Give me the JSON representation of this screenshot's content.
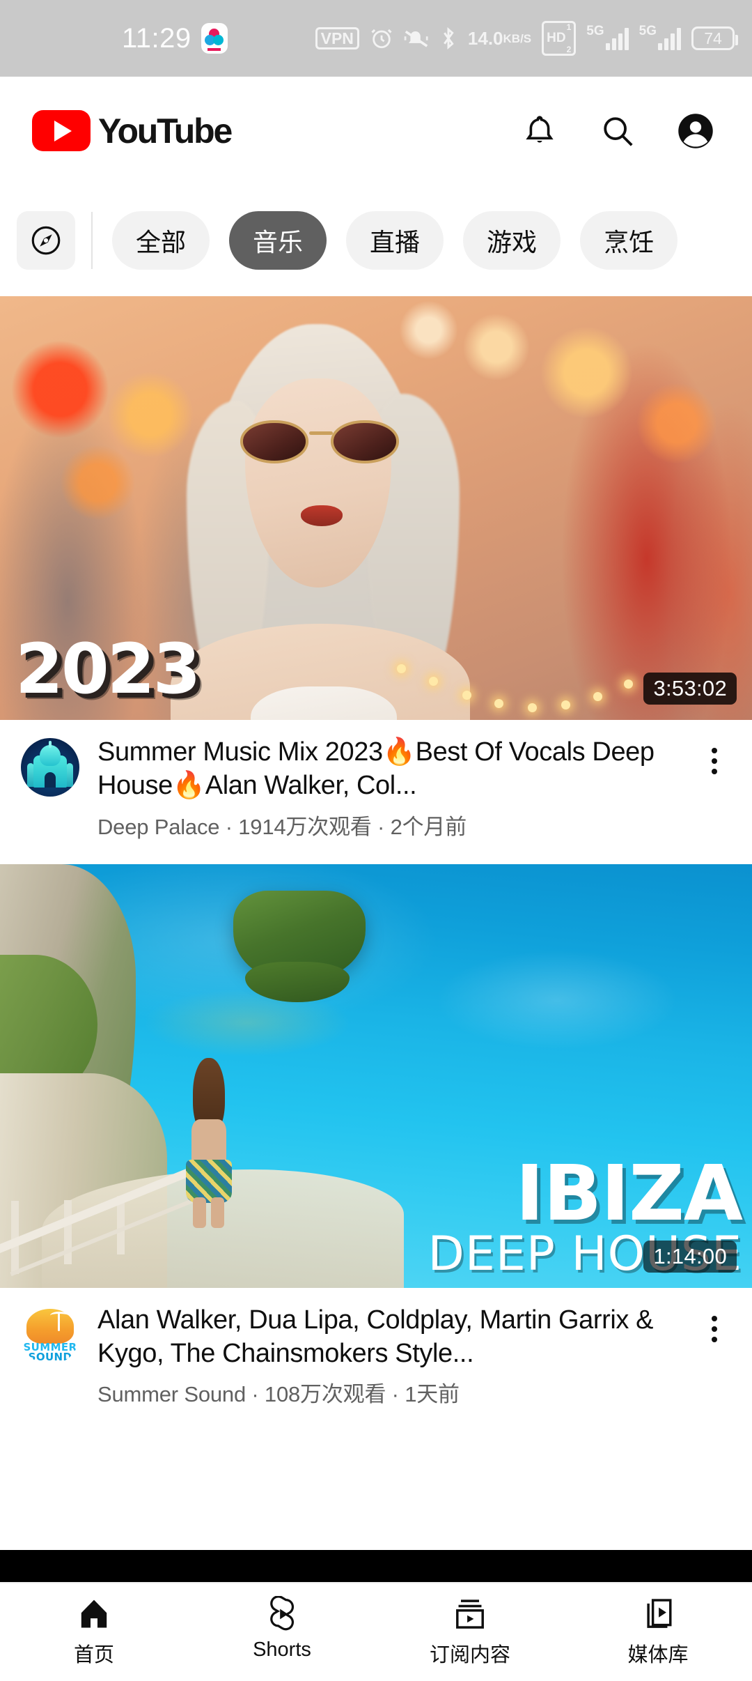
{
  "statusbar": {
    "time": "11:29",
    "app_icon": "mi-cloud-icon",
    "vpn_label": "VPN",
    "alarm_icon": "alarm-clock-icon",
    "mute_icon": "bell-muted-icon",
    "bluetooth_icon": "bluetooth-icon",
    "netspeed_value": "14.0",
    "netspeed_unit": "KB/S",
    "hd_label": "HD",
    "hd_sup": "1",
    "hd_sub": "2",
    "sim1_label": "5G",
    "sim2_label": "5G",
    "battery": "74"
  },
  "header": {
    "logo_text": "YouTube",
    "notifications_icon": "bell-icon",
    "search_icon": "search-icon",
    "account_icon": "account-avatar-icon"
  },
  "chips": {
    "explore_icon": "compass-icon",
    "items": [
      {
        "label": "全部",
        "active": false
      },
      {
        "label": "音乐",
        "active": true
      },
      {
        "label": "直播",
        "active": false
      },
      {
        "label": "游戏",
        "active": false
      },
      {
        "label": "烹饪",
        "active": false
      }
    ]
  },
  "feed": {
    "videos": [
      {
        "title": "Summer Music Mix 2023🔥Best Of Vocals Deep House🔥Alan Walker, Col...",
        "channel": "Deep Palace",
        "views": "1914万次观看",
        "age": "2个月前",
        "meta_line": "Deep Palace · 1914万次观看 · 2个月前",
        "duration": "3:53:02",
        "thumb_overlay_text": "2023",
        "avatar_name": "deep-palace-avatar",
        "menu_icon": "kebab-menu-icon"
      },
      {
        "title": "Alan Walker, Dua Lipa, Coldplay, Martin Garrix & Kygo, The Chainsmokers Style...",
        "channel": "Summer Sound",
        "views": "108万次观看",
        "age": "1天前",
        "meta_line": "Summer Sound · 108万次观看 · 1天前",
        "duration": "1:14:00",
        "thumb_overlay_title": "IBIZA",
        "thumb_overlay_sub": "DEEP HOUSE",
        "avatar_name": "summer-sound-avatar",
        "avatar_text_line1": "SUMMER",
        "avatar_text_line2": "SOUND",
        "menu_icon": "kebab-menu-icon"
      }
    ]
  },
  "bottom_nav": {
    "items": [
      {
        "label": "首页",
        "icon": "home-icon",
        "active": true
      },
      {
        "label": "Shorts",
        "icon": "shorts-icon",
        "active": false
      },
      {
        "label": "订阅内容",
        "icon": "subscriptions-icon",
        "active": false
      },
      {
        "label": "媒体库",
        "icon": "library-icon",
        "active": false
      }
    ]
  },
  "colors": {
    "brand_red": "#ff0000",
    "chip_active_bg": "#606060",
    "chip_bg": "#f2f2f2",
    "text_primary": "#0f0f0f",
    "text_secondary": "#606060"
  }
}
